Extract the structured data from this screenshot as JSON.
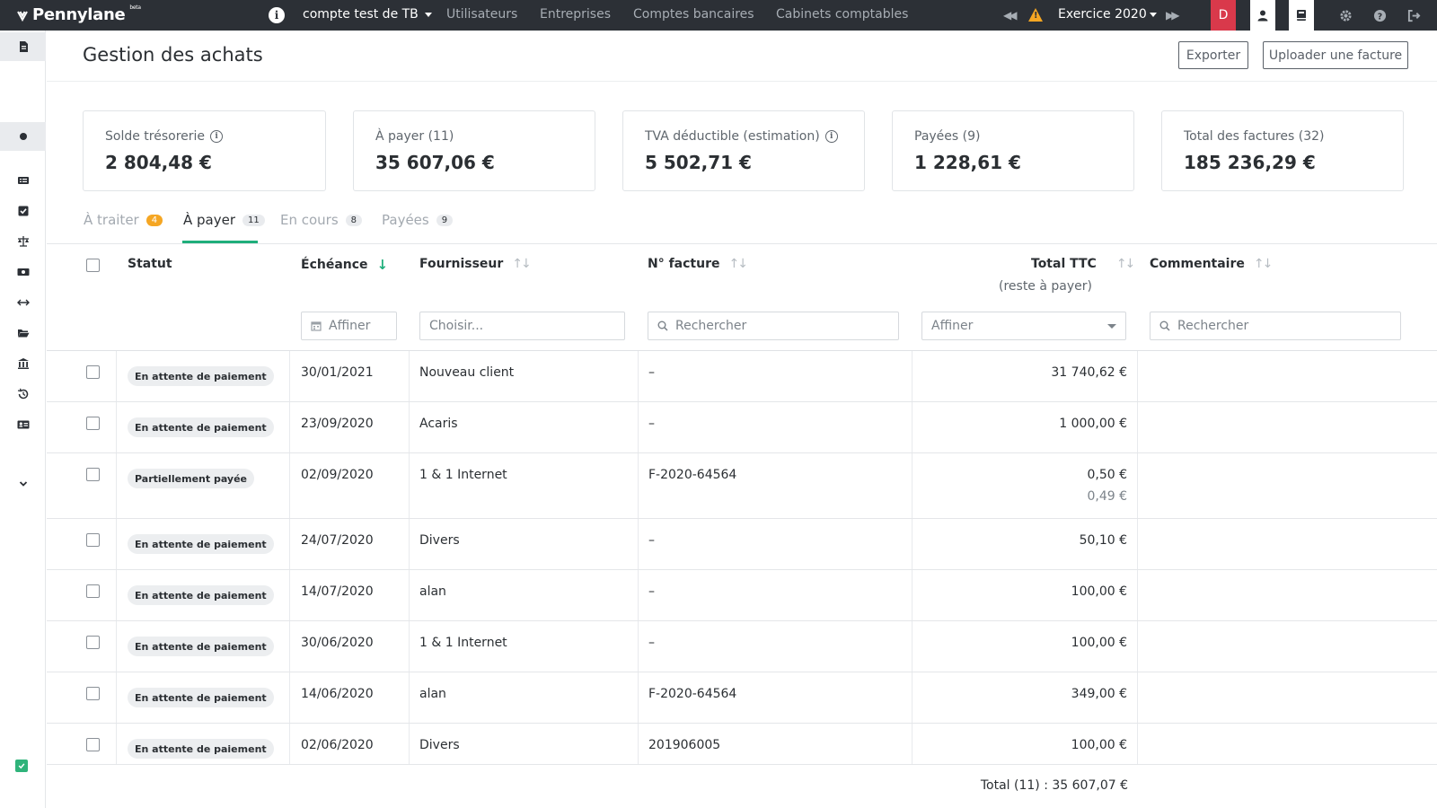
{
  "topbar": {
    "brand": "Pennylane",
    "brand_tag": "beta",
    "account": "compte test de TB",
    "nav": [
      "Utilisateurs",
      "Entreprises",
      "Comptes bancaires",
      "Cabinets comptables"
    ],
    "exercice": "Exercice 2020",
    "avatar_letter": "D",
    "accent_red": "#d9394b",
    "bar_color": "#2c3036"
  },
  "header": {
    "title": "Gestion des achats",
    "export_label": "Exporter",
    "upload_label": "Uploader une facture"
  },
  "cards": [
    {
      "label": "Solde trésorerie",
      "value": "2 804,48 €",
      "info": true
    },
    {
      "label": "À payer (11)",
      "value": "35 607,06 €",
      "info": false
    },
    {
      "label": "TVA déductible (estimation)",
      "value": "5 502,71 €",
      "info": true
    },
    {
      "label": "Payées (9)",
      "value": "1 228,61 €",
      "info": false
    },
    {
      "label": "Total des factures (32)",
      "value": "185 236,29 €",
      "info": false
    }
  ],
  "tabs": [
    {
      "label": "À traiter",
      "count": "4"
    },
    {
      "label": "À payer",
      "count": "11"
    },
    {
      "label": "En cours",
      "count": "8"
    },
    {
      "label": "Payées",
      "count": "9"
    }
  ],
  "columns": {
    "status": "Statut",
    "due": "Échéance",
    "supplier": "Fournisseur",
    "invoice": "N° facture",
    "total": "Total TTC",
    "total_sub": "(reste à payer)",
    "comment": "Commentaire"
  },
  "filters": {
    "due": "Affiner",
    "supplier": "Choisir...",
    "invoice": "Rechercher",
    "total": "Affiner",
    "comment": "Rechercher"
  },
  "rows": [
    {
      "status": "En attente de paiement",
      "due": "30/01/2021",
      "supplier": "Nouveau client",
      "invoice": "–",
      "total": "31 740,62 €",
      "remaining": ""
    },
    {
      "status": "En attente de paiement",
      "due": "23/09/2020",
      "supplier": "Acaris",
      "invoice": "–",
      "total": "1 000,00 €",
      "remaining": ""
    },
    {
      "status": "Partiellement payée",
      "due": "02/09/2020",
      "supplier": "1 & 1 Internet",
      "invoice": "F-2020-64564",
      "total": "0,50 €",
      "remaining": "0,49 €"
    },
    {
      "status": "En attente de paiement",
      "due": "24/07/2020",
      "supplier": "Divers",
      "invoice": "–",
      "total": "50,10 €",
      "remaining": ""
    },
    {
      "status": "En attente de paiement",
      "due": "14/07/2020",
      "supplier": "alan",
      "invoice": "–",
      "total": "100,00 €",
      "remaining": ""
    },
    {
      "status": "En attente de paiement",
      "due": "30/06/2020",
      "supplier": "1 & 1 Internet",
      "invoice": "–",
      "total": "100,00 €",
      "remaining": ""
    },
    {
      "status": "En attente de paiement",
      "due": "14/06/2020",
      "supplier": "alan",
      "invoice": "F-2020-64564",
      "total": "349,00 €",
      "remaining": ""
    },
    {
      "status": "En attente de paiement",
      "due": "02/06/2020",
      "supplier": "Divers",
      "invoice": "201906005",
      "total": "100,00 €",
      "remaining": ""
    }
  ],
  "footer": {
    "total": "Total (11) : 35 607,07 €"
  },
  "colors": {
    "accent_green": "#1fae7b",
    "badge_orange": "#f5a623"
  }
}
